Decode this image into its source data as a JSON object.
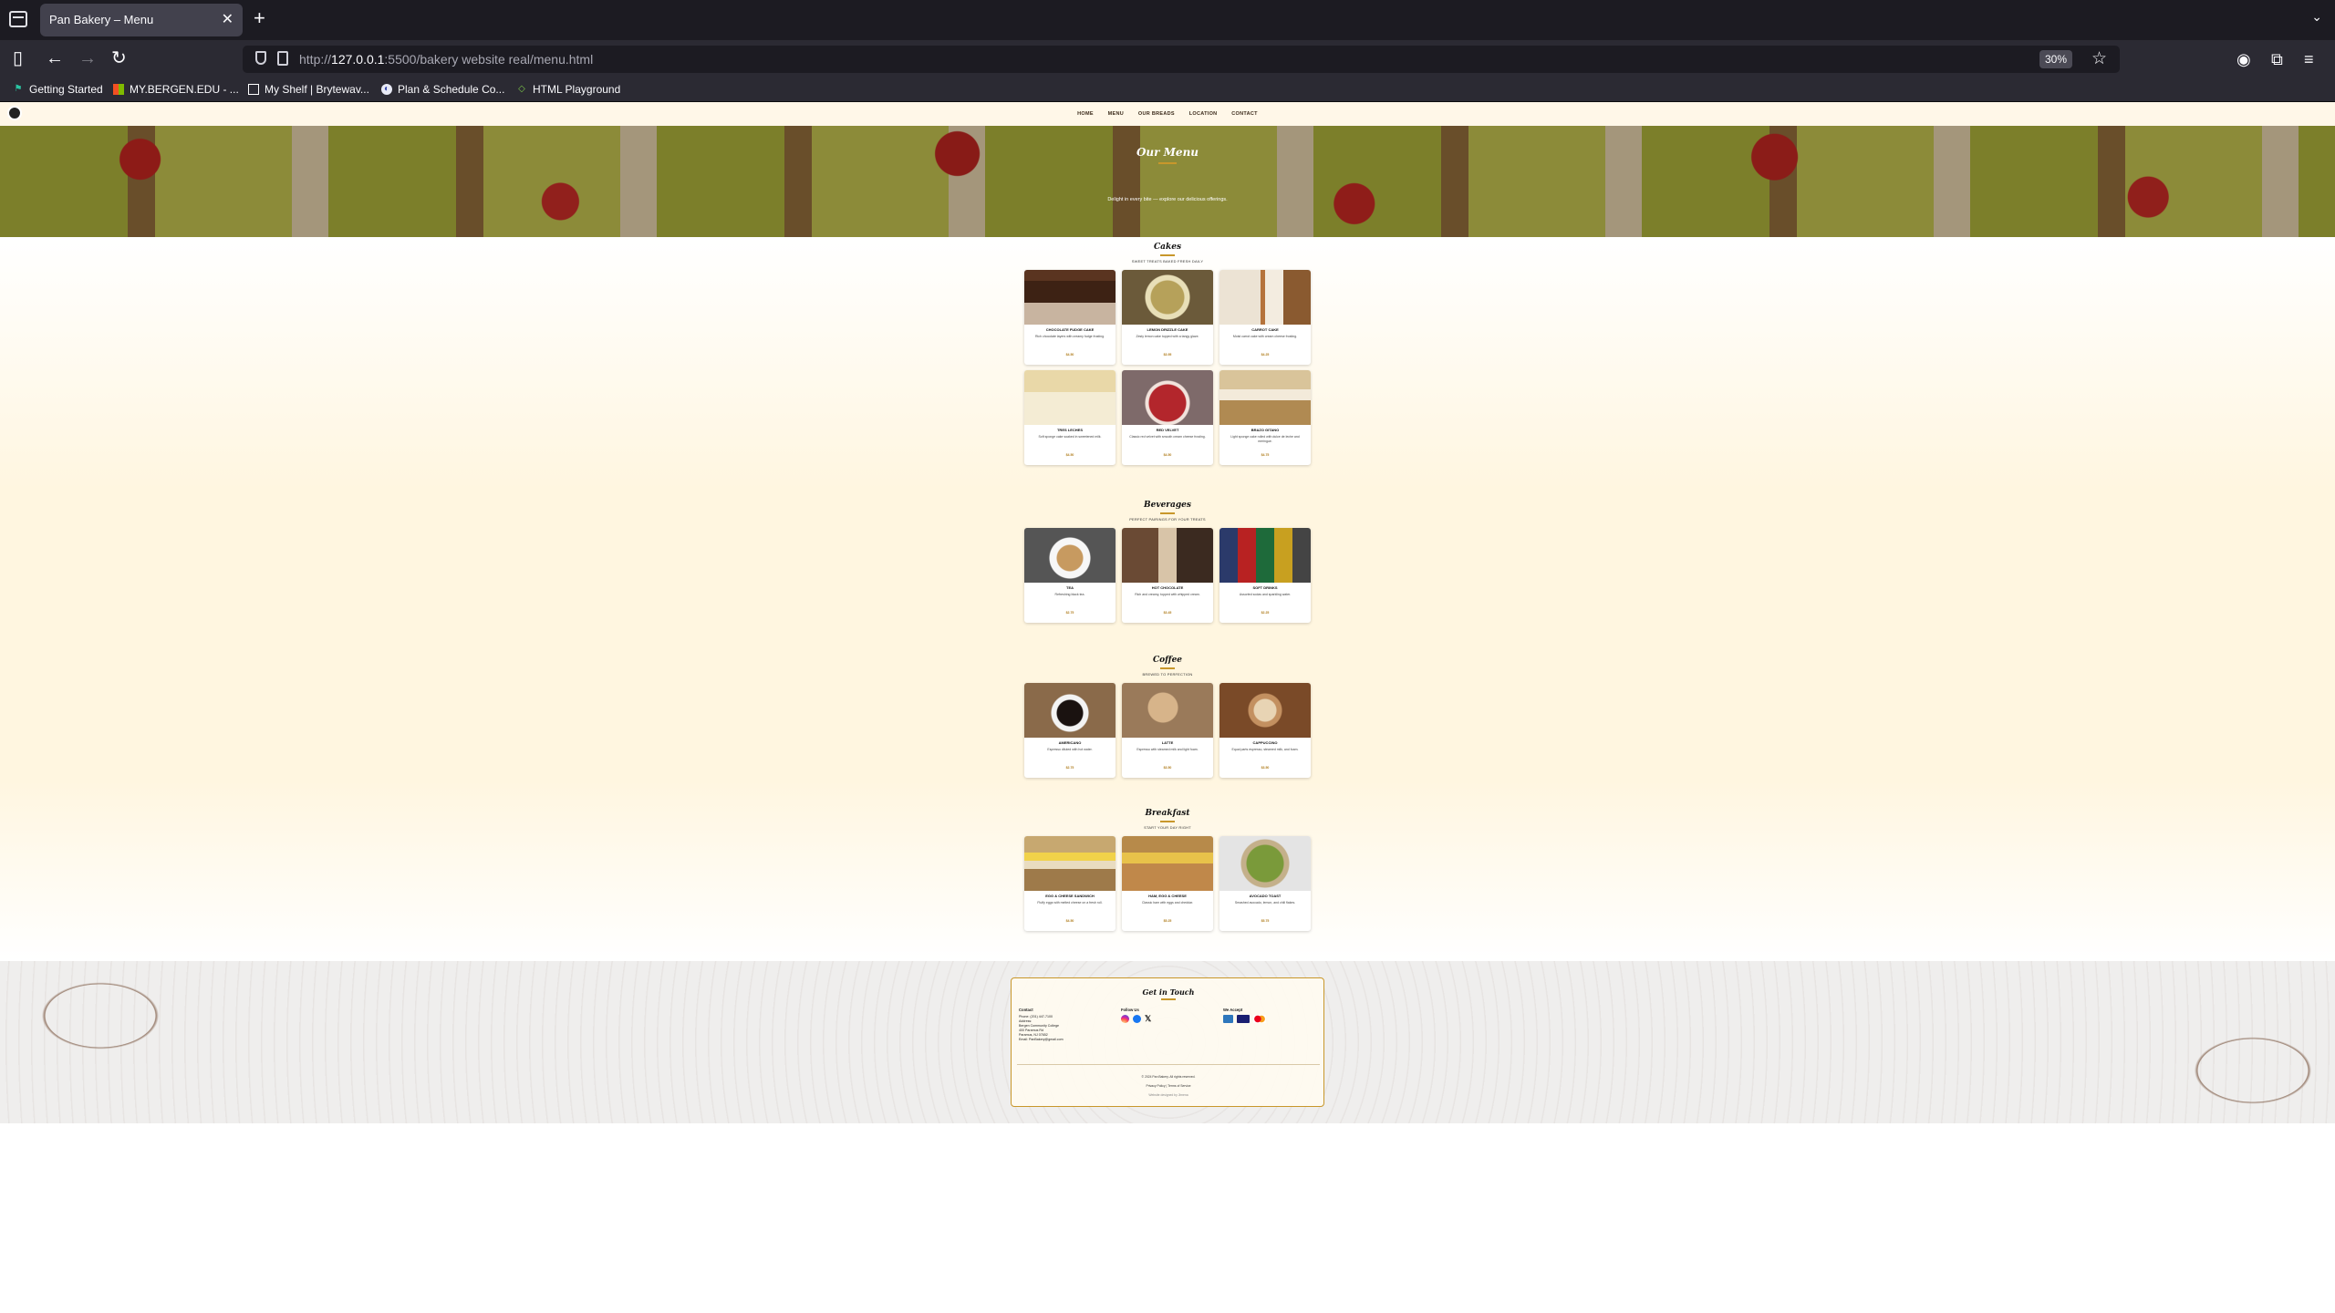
{
  "browser": {
    "tab_title": "Pan Bakery – Menu",
    "url_prefix": "http://",
    "url_host": "127.0.0.1",
    "url_rest": ":5500/bakery website real/menu.html",
    "zoom": "30%",
    "bookmarks": [
      "Getting Started",
      "MY.BERGEN.EDU - ...",
      "My Shelf | Brytewav...",
      "Plan & Schedule Co...",
      "HTML Playground"
    ]
  },
  "site": {
    "nav": [
      "HOME",
      "MENU",
      "OUR BREADS",
      "LOCATION",
      "CONTACT"
    ],
    "hero_title": "Our Menu",
    "hero_tagline": "Delight in every bite — explore our delicious offerings.",
    "sections": [
      {
        "title": "Cakes",
        "subtitle": "SWEET TREATS BAKED FRESH DAILY",
        "items": [
          {
            "name": "CHOCOLATE FUDGE CAKE",
            "desc": "Rich chocolate layers with creamy fudge frosting.",
            "price": "$4.50"
          },
          {
            "name": "LEMON DRIZZLE CAKE",
            "desc": "Zesty lemon cake topped with a tangy glaze.",
            "price": "$3.95"
          },
          {
            "name": "CARROT CAKE",
            "desc": "Moist carrot cake with cream cheese frosting.",
            "price": "$4.25"
          },
          {
            "name": "TRES LECHES",
            "desc": "Soft sponge cake soaked in sweetened milk.",
            "price": "$4.50"
          },
          {
            "name": "RED VELVET",
            "desc": "Classic red velvet with smooth cream cheese frosting.",
            "price": "$4.50"
          },
          {
            "name": "BRAZO GITANO",
            "desc": "Light sponge cake rolled with dulce de leche and meringue.",
            "price": "$4.75"
          }
        ]
      },
      {
        "title": "Beverages",
        "subtitle": "PERFECT PAIRINGS FOR YOUR TREATS",
        "items": [
          {
            "name": "TEA",
            "desc": "Refreshing black tea.",
            "price": "$2.75"
          },
          {
            "name": "HOT CHOCOLATE",
            "desc": "Rich and creamy, topped with whipped cream.",
            "price": "$3.45"
          },
          {
            "name": "SOFT DRINKS",
            "desc": "Assorted sodas and sparkling water.",
            "price": "$2.25"
          }
        ]
      },
      {
        "title": "Coffee",
        "subtitle": "BREWED TO PERFECTION",
        "items": [
          {
            "name": "AMERICANO",
            "desc": "Espresso diluted with hot water.",
            "price": "$2.75"
          },
          {
            "name": "LATTE",
            "desc": "Espresso with steamed milk and light foam.",
            "price": "$3.50"
          },
          {
            "name": "CAPPUCCINO",
            "desc": "Equal parts espresso, steamed milk, and foam.",
            "price": "$3.50"
          }
        ]
      },
      {
        "title": "Breakfast",
        "subtitle": "START YOUR DAY RIGHT",
        "items": [
          {
            "name": "EGG & CHEESE SANDWICH",
            "desc": "Fluffy eggs with melted cheese on a fresh roll.",
            "price": "$4.50"
          },
          {
            "name": "HAM, EGG & CHEESE",
            "desc": "Classic ham with eggs and cheddar.",
            "price": "$5.25"
          },
          {
            "name": "AVOCADO TOAST",
            "desc": "Smashed avocado, lemon, and chili flakes.",
            "price": "$5.75"
          }
        ]
      }
    ],
    "footer": {
      "title": "Get in Touch",
      "contact_heading": "Contact",
      "phone": "Phone: (201) 447-7100",
      "address_label": "Address:",
      "address_1": "Bergen Community College",
      "address_2": "400 Paramus Rd",
      "address_3": "Paramus, NJ 07652",
      "email": "Email: PanBakery@gmail.com",
      "follow_heading": "Follow Us",
      "accept_heading": "We Accept",
      "copyright": "© 2024 Pan Bakery. All rights reserved.",
      "links": "Privacy Policy | Terms of Service",
      "credit": "Website designed by Jimena"
    }
  },
  "colors": {
    "accent": "#c8972b",
    "price": "#b07d1e",
    "nav_bg": "#fff7e8"
  }
}
